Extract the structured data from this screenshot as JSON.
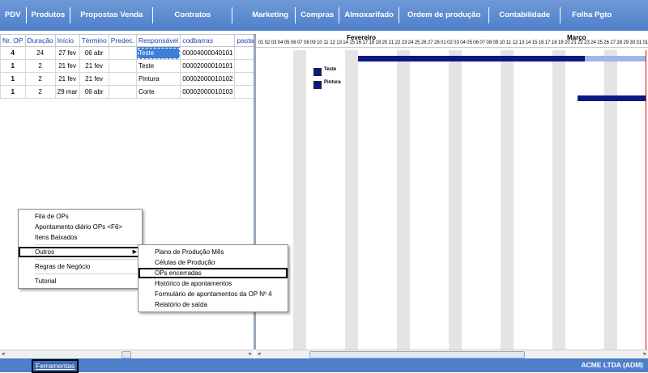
{
  "topmenu": [
    "PDV",
    "Produtos",
    "Propostas Venda",
    "Contratos",
    "Marketing",
    "Compras",
    "Almoxarifado",
    "Ordem de produção",
    "Contabilidade",
    "Folha Pgto"
  ],
  "grid": {
    "headers": [
      "Nr. OP",
      "Duração",
      "Início",
      "Término",
      "Predec.",
      "Responsável",
      "codbarras",
      "pasta_i"
    ],
    "rows": [
      [
        "4",
        "24",
        "27 fev",
        "06 abr",
        "",
        "Teste",
        "00004000040101",
        ""
      ],
      [
        "1",
        "2",
        "21 fev",
        "21 fev",
        "",
        "Teste",
        "00002000010101",
        ""
      ],
      [
        "1",
        "2",
        "21 fev",
        "21 fev",
        "",
        "Pintura",
        "00002000010102",
        ""
      ],
      [
        "1",
        "2",
        "29 mar",
        "06 abr",
        "",
        "Corte",
        "00002000010103",
        ""
      ]
    ]
  },
  "gantt": {
    "months": [
      "Fevereiro",
      "Março"
    ],
    "days": [
      "01",
      "02",
      "03",
      "04",
      "05",
      "06",
      "07",
      "08",
      "09",
      "10",
      "11",
      "12",
      "13",
      "14",
      "15",
      "16",
      "17",
      "18",
      "19",
      "20",
      "21",
      "22",
      "23",
      "24",
      "25",
      "26",
      "27",
      "28",
      "01",
      "02",
      "03",
      "04",
      "05",
      "06",
      "07",
      "08",
      "09",
      "10",
      "11",
      "12",
      "13",
      "14",
      "15",
      "16",
      "17",
      "18",
      "19",
      "20",
      "21",
      "22",
      "23",
      "24",
      "25",
      "26",
      "27",
      "28",
      "29",
      "30",
      "31",
      "01"
    ],
    "legend": [
      "Teste",
      "Pintura"
    ]
  },
  "menu_main": {
    "items": [
      "Fila de OPs",
      "Apontamento diário OPs <F6>",
      "Itens Baixados",
      "Outros",
      "Regras de Negócio",
      "Tutorial"
    ]
  },
  "menu_sub": {
    "items": [
      "Plano de Produção Mês",
      "Células de Produção",
      "OPs encerradas",
      "Histórico de apontamentos",
      "Formulário de apontamentos da OP Nº 4",
      "Relatório de saída"
    ]
  },
  "bottom": {
    "tools_label": "Ferramentas",
    "company": "ACME LTDA (ADM)"
  },
  "colors": {
    "accent": "#4f7fc9",
    "bar": "#0a1a80",
    "header_text": "#1a3fb0"
  }
}
